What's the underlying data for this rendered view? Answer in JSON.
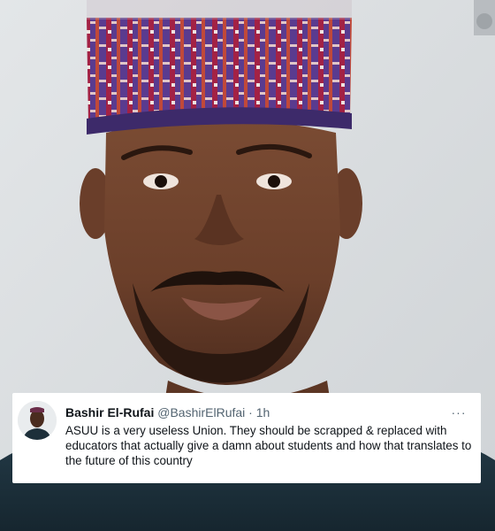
{
  "tweet": {
    "display_name": "Bashir El-Rufai",
    "handle": "@BashirElRufai",
    "separator": "·",
    "time": "1h",
    "more": "···",
    "text": "ASUU is a very useless Union. They should be scrapped & replaced with educators that actually give a damn about students and how that translates to the future of this country"
  },
  "colors": {
    "name": "#0f1419",
    "meta": "#536471",
    "card_bg": "#ffffff",
    "cap_red": "#a32245",
    "cap_purple": "#5a3b8f"
  }
}
